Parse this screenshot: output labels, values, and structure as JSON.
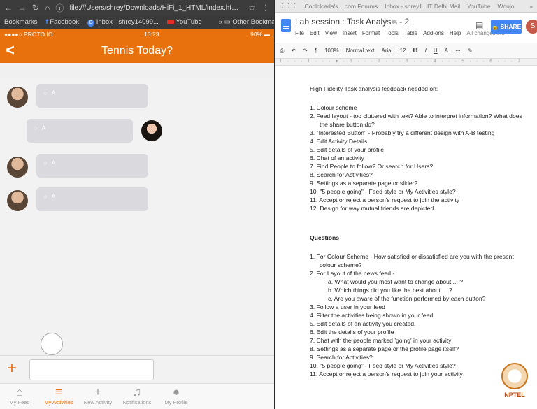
{
  "left_browser": {
    "url": "file:///Users/shrey/Downloads/HiFi_1_HTML/index.html#4",
    "bookmarks": [
      "Bookmarks",
      "Facebook",
      "Inbox - shrey14099...",
      "YouTube"
    ],
    "other_bookmarks": "Other Bookmarks"
  },
  "phone": {
    "carrier": "●●●●○ PROTO.IO",
    "time": "13:23",
    "battery": "90%",
    "title": "Tennis Today?",
    "bubble_placeholder": "○ A",
    "tabs": [
      "My Feed",
      "My Activities",
      "New Activity",
      "Notifications",
      "My Profile"
    ],
    "active_tab": "My Activities",
    "accent": "#e8700d"
  },
  "right_browser": {
    "bookmarks": [
      "Coolclcada's....com Forums",
      "Inbox - shrey1...IT Delhi Mail",
      "YouTube",
      "Woujo"
    ],
    "doc_title": "Lab session : Task Analysis - 2",
    "menu": [
      "File",
      "Edit",
      "View",
      "Insert",
      "Format",
      "Tools",
      "Table",
      "Add-ons",
      "Help",
      "All changes s..."
    ],
    "share": "SHARE",
    "user_initial": "S",
    "toolbar": {
      "zoom": "100%",
      "style": "Normal text",
      "font": "Arial",
      "size": "12"
    }
  },
  "document": {
    "heading": "High Fidelity Task analysis feedback needed on:",
    "items": [
      "1.  Colour scheme",
      "2.  Feed layout - too cluttered with text? Able to interpret information? What does the share button do?",
      "3.  \"Interested Button\" - Probably try a different design with A-B testing",
      "4.  Edit Activity Details",
      "5.  Edit details of your profile",
      "6.  Chat of an activity",
      "7.  Find People to follow? Or search for Users?",
      "8.  Search for Activities?",
      "9.  Settings as a separate page or slider?",
      "10. \"5 people going\" - Feed style or My Activities style?",
      "11. Accept or reject a person's request to join the activity",
      "12. Design for way mutual friends are depicted"
    ],
    "questions_heading": "Questions",
    "questions": [
      "1.  For Colour Scheme - How satisfied or dissatisfied are you with the present colour scheme?",
      "2.  For Layout of the news feed -",
      "a.  What would you most want to change about ... ?",
      "b.  Which things did you like the best about ... ?",
      "c.  Are you aware of the function performed by each button?",
      "3.  Follow a user in your feed",
      "4.  Filter the activities being shown in your feed",
      "5.  Edit details of an activity you created.",
      "6.  Edit the details of your profile",
      "7.  Chat with the people marked 'going' in your activity",
      "8.  Settings as a separate page or the profile page itself?",
      "9.  Search for Activities?",
      "10. \"5 people going\" - Feed style or My Activities style?",
      "11. Accept or reject a person's request to join your activity"
    ]
  },
  "watermark": "NPTEL"
}
